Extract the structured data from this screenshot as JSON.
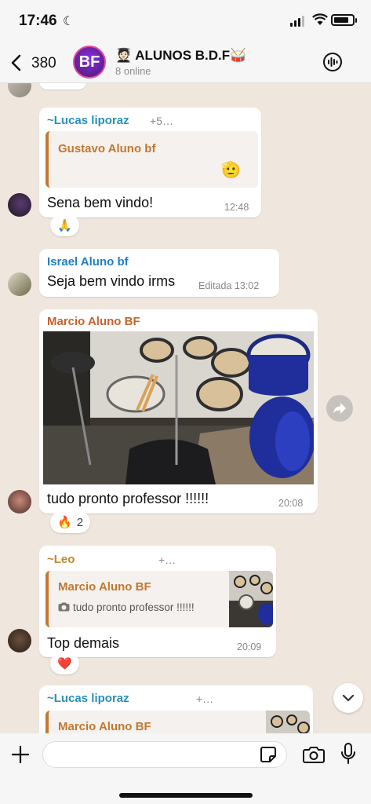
{
  "status_bar": {
    "time": "17:46"
  },
  "header": {
    "back_count": "380",
    "avatar_initials": "BF",
    "group_name": "🧑🏻‍🎓 ALUNOS B.D.F🥁",
    "group_status": "8 online"
  },
  "messages": [
    {
      "sender": "~Lucas liporaz",
      "sender_color": "#2a8fb8",
      "phone": "+5…",
      "quote": {
        "sender": "Gustavo Aluno bf",
        "text": "🫡"
      },
      "text": "Sena bem vindo!",
      "time": "12:48",
      "reaction": {
        "emoji": "🙏",
        "count": ""
      }
    },
    {
      "sender": "Israel Aluno bf",
      "sender_color": "#1f7fc4",
      "text": "Seja bem vindo irms",
      "time": "Editada 13:02"
    },
    {
      "sender": "Marcio Aluno BF",
      "sender_color": "#c8622c",
      "image_alt": "drum kit",
      "text": "tudo pronto professor !!!!!!",
      "time": "20:08",
      "reaction": {
        "emoji": "🔥",
        "count": "2"
      }
    },
    {
      "sender": "~Leo",
      "sender_color": "#c0872a",
      "phone": "+…",
      "quote": {
        "sender": "Marcio Aluno BF",
        "text": "tudo pronto professor !!!!!!"
      },
      "text": "Top demais",
      "time": "20:09",
      "reaction": {
        "emoji": "❤️",
        "count": ""
      }
    },
    {
      "sender": "~Lucas liporaz",
      "sender_color": "#2a8fb8",
      "phone": "+…",
      "quote": {
        "sender": "Marcio Aluno BF",
        "text": ""
      }
    }
  ],
  "input": {
    "placeholder": ""
  },
  "colors": {
    "background": "#efe7de",
    "quote_accent": "#c2782e",
    "bubble": "#ffffff"
  }
}
